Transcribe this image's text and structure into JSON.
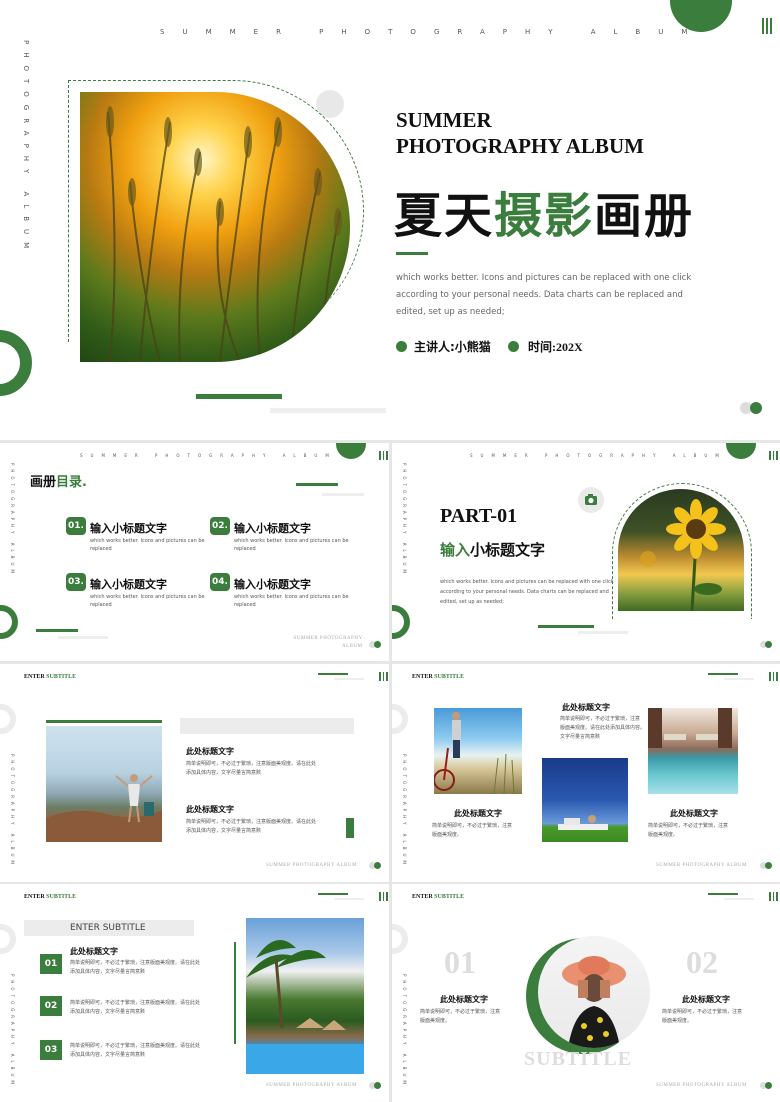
{
  "cover": {
    "top_tagline": "SUMMER PHOTOGRAPHY ALBUM",
    "side_tagline": "PHOTOGRAPHY ALBUM",
    "title_en_1": "SUMMER",
    "title_en_2": "PHOTOGRAPHY ALBUM",
    "title_cn_a": "夏天",
    "title_cn_b": "摄影",
    "title_cn_c": "画册",
    "desc_1": "which works better. Icons and pictures can be replaced with one click",
    "desc_2": "according to your personal needs. Data charts can be replaced and",
    "desc_3": "edited, set up as needed;",
    "presenter": "主讲人:小熊猫",
    "time": "时间:202X"
  },
  "toc": {
    "top_tagline": "SUMMER PHOTOGRAPHY ALBUM",
    "side_tagline": "PHOTOGRAPHY ALBUM",
    "title_a": "画册",
    "title_b": "目录",
    "title_dot": ".",
    "items": [
      {
        "num": "01.",
        "title": "输入小标题文字",
        "desc_1": "which works better. Icons and pictures can be",
        "desc_2": "replaced"
      },
      {
        "num": "02.",
        "title": "输入小标题文字",
        "desc_1": "which works better. Icons and pictures can be",
        "desc_2": "replaced"
      },
      {
        "num": "03.",
        "title": "输入小标题文字",
        "desc_1": "which works better. Icons and pictures can be",
        "desc_2": "replaced"
      },
      {
        "num": "04.",
        "title": "输入小标题文字",
        "desc_1": "which works better. Icons and pictures can be",
        "desc_2": "replaced"
      }
    ],
    "footer_1": "SUMMER PHOTOGRAPHY",
    "footer_2": "ALBUM"
  },
  "part": {
    "top_tagline": "SUMMER PHOTOGRAPHY ALBUM",
    "side_tagline": "PHOTOGRAPHY ALBUM",
    "title": "PART-01",
    "subtitle_a": "输入",
    "subtitle_b": "小标题文字",
    "desc_1": "which works better. Icons and pictures can be replaced with one click",
    "desc_2": "according to your personal needs. Data charts can be replaced and",
    "desc_3": "edited, set up as needed;"
  },
  "s4": {
    "header_a": "ENTER",
    "header_b": "SUBTITLE",
    "side_tagline": "PHOTOGRAPHY ALBUM",
    "block1_title": "此处标题文字",
    "block1_1": "简单说明即可，不必过于繁琐，注意版面美观度。请在此处",
    "block1_2": "添加具体内容，文字尽量言简意赅",
    "block2_title": "此处标题文字",
    "block2_1": "简单说明即可，不必过于繁琐，注意版面美观度。请在此处",
    "block2_2": "添加具体内容，文字尽量言简意赅",
    "footer": "SUMMER PHOTOGRAPHY ALBUM"
  },
  "s5": {
    "header_a": "ENTER",
    "header_b": "SUBTITLE",
    "side_tagline": "PHOTOGRAPHY ALBUM",
    "top_title": "此处标题文字",
    "top_1": "简单说明即可，不必过于繁琐，注意",
    "top_2": "版面美观度。请在此处添加具体内容。",
    "top_3": "文字尽量言简意赅",
    "left_title": "此处标题文字",
    "left_1": "简单说明即可，不必过于繁琐，注意",
    "left_2": "版面美观度。",
    "right_title": "此处标题文字",
    "right_1": "简单说明即可，不必过于繁琐，注意",
    "right_2": "版面美观度。",
    "footer": "SUMMER PHOTOGRAPHY ALBUM"
  },
  "s6": {
    "header_a": "ENTER",
    "header_b": "SUBTITLE",
    "side_tagline": "PHOTOGRAPHY ALBUM",
    "banner": "ENTER SUBTITLE",
    "items": [
      {
        "num": "01",
        "title": "此处标题文字",
        "line_1": "简单说明即可，不必过于繁琐，注意版面美观度。请在此处",
        "line_2": "添加具体内容，文字尽量言简意赅"
      },
      {
        "num": "02",
        "title": "",
        "line_1": "简单说明即可，不必过于繁琐，注意版面美观度。请在此处",
        "line_2": "添加具体内容，文字尽量言简意赅"
      },
      {
        "num": "03",
        "title": "",
        "line_1": "简单说明即可，不必过于繁琐，注意版面美观度。请在此处",
        "line_2": "添加具体内容，文字尽量言简意赅"
      }
    ],
    "footer": "SUMMER PHOTOGRAPHY ALBUM"
  },
  "s7": {
    "header_a": "ENTER",
    "header_b": "SUBTITLE",
    "side_tagline": "PHOTOGRAPHY ALBUM",
    "num_1": "01",
    "num_2": "02",
    "left_title": "此处标题文字",
    "left_1": "简单说明即可，不必过于繁琐，注意",
    "left_2": "版面美观度。",
    "right_title": "此处标题文字",
    "right_1": "简单说明即可，不必过于繁琐，注意",
    "right_2": "版面美观度。",
    "big_subtitle": "SUBTITLE",
    "footer": "SUMMER PHOTOGRAPHY ALBUM"
  },
  "colors": {
    "accent": "#3a7d3c",
    "light_gray": "#e6e6e6"
  }
}
